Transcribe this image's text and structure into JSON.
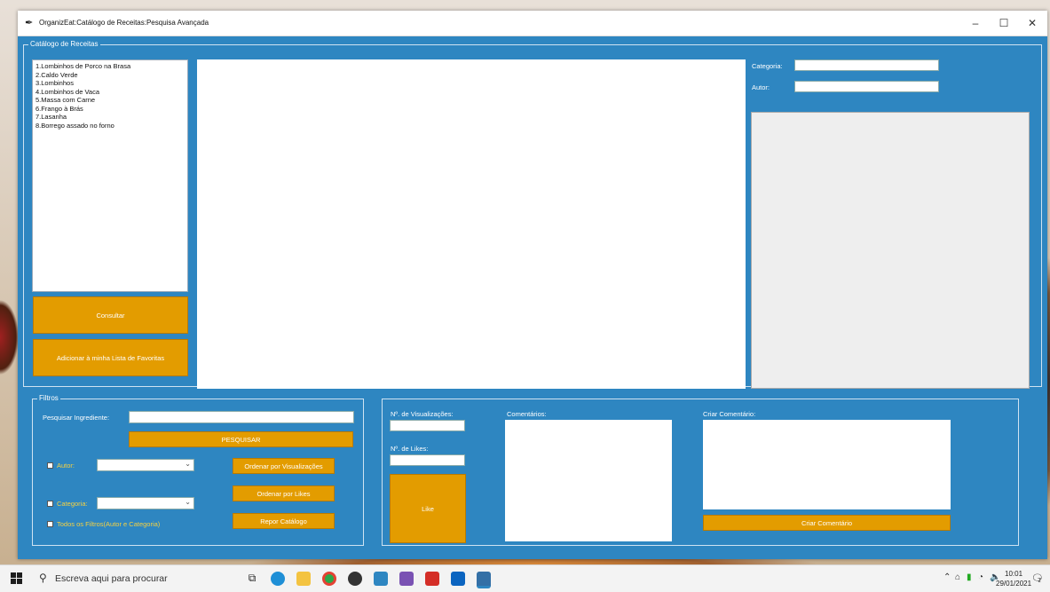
{
  "window": {
    "title": "OrganizEat:Catálogo de Receitas:Pesquisa Avançada",
    "minimize": "–",
    "maximize": "☐",
    "close": "✕"
  },
  "catalog": {
    "legend": "Catálogo de Receitas",
    "recipes": [
      "1.Lombinhos de Porco na Brasa",
      "2.Caldo Verde",
      "3.Lombinhos",
      "4.Lombinhos de Vaca",
      "5.Massa com Carne",
      "6.Frango à Brás",
      "7.Lasanha",
      "8.Borrego assado no forno"
    ],
    "consult_label": "Consultar",
    "favorites_label": "Adicionar à minha Lista de Favoritas",
    "category_label": "Categoria:",
    "author_label": "Autor:"
  },
  "filters": {
    "legend": "Filtros",
    "ingredient_label": "Pesquisar Ingrediente:",
    "search_button": "PESQUISAR",
    "author_label": "Autor:",
    "category_label": "Categoria:",
    "all_filters_label": "Todos os Filtros(Autor e Categoria)",
    "sort_views_button": "Ordenar por Visualizações",
    "sort_likes_button": "Ordenar por Likes",
    "reset_button": "Repor Catálogo"
  },
  "interactions": {
    "views_label": "Nº. de Visualizações:",
    "likes_label": "Nº. de Likes:",
    "like_button": "Like",
    "comments_label": "Comentários:",
    "create_comment_label": "Criar Comentário:",
    "create_comment_button": "Criar Comentário"
  },
  "taskbar": {
    "search_placeholder": "Escreva aqui para procurar",
    "time": "10:01",
    "date": "29/01/2021",
    "notification_count": "7"
  },
  "colors": {
    "window_bg": "#2e86c1",
    "button": "#e39c00",
    "label_highlight": "#f5d142"
  }
}
